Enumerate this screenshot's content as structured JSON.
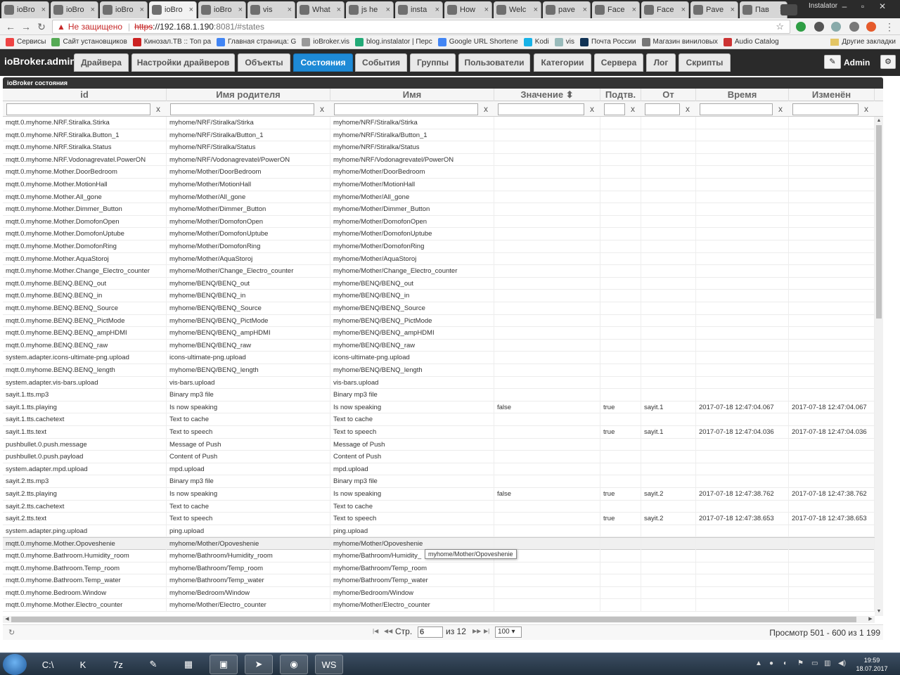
{
  "browser": {
    "tabs": [
      {
        "label": "ioBro",
        "icon": "iobroker-icon"
      },
      {
        "label": "ioBro",
        "icon": "iobroker-icon"
      },
      {
        "label": "ioBro",
        "icon": "iobroker-icon"
      },
      {
        "label": "ioBro",
        "icon": "iobroker-icon"
      },
      {
        "label": "ioBro",
        "icon": "iobroker-icon"
      },
      {
        "label": "vis",
        "icon": "vis-icon"
      },
      {
        "label": "What",
        "icon": "whatsapp-icon"
      },
      {
        "label": "js he",
        "icon": "google-icon"
      },
      {
        "label": "insta",
        "icon": "github-icon"
      },
      {
        "label": "How",
        "icon": "stackoverflow-icon"
      },
      {
        "label": "Welc",
        "icon": "page-icon"
      },
      {
        "label": "pave",
        "icon": "google-icon"
      },
      {
        "label": "Face",
        "icon": "facebook-icon"
      },
      {
        "label": "Face",
        "icon": "facebook-icon"
      },
      {
        "label": "Pave",
        "icon": "page-icon"
      },
      {
        "label": "Пав",
        "icon": "linkedin-icon"
      }
    ],
    "profile_name": "Instalator",
    "address": {
      "security_label": "Не защищено",
      "scheme": "https",
      "host": "://192.168.1.190",
      "rest": ":8081/#states"
    },
    "bookmarks": [
      {
        "label": "Сервисы",
        "color": "#e44"
      },
      {
        "label": "Сайт установщиков",
        "color": "#5a5"
      },
      {
        "label": "Кинозал.ТВ :: Топ ра",
        "color": "#c22"
      },
      {
        "label": "Главная страница: G",
        "color": "#4285f4"
      },
      {
        "label": "ioBroker.vis",
        "color": "#999"
      },
      {
        "label": "blog.instalator | Перс",
        "color": "#2a7"
      },
      {
        "label": "Google URL Shortene",
        "color": "#4285f4"
      },
      {
        "label": "Kodi",
        "color": "#17b2e7"
      },
      {
        "label": "vis",
        "color": "#9bb"
      },
      {
        "label": "Почта России",
        "color": "#135"
      },
      {
        "label": "Магазин виниловых",
        "color": "#777"
      },
      {
        "label": "Audio Catalog",
        "color": "#c33"
      }
    ],
    "other_bookmarks": "Другие закладки"
  },
  "app": {
    "brand": "ioBroker.admin",
    "nav": [
      {
        "label": "Драйвера",
        "active": false
      },
      {
        "label": "Настройки драйверов",
        "active": false
      },
      {
        "label": "Объекты",
        "active": false
      },
      {
        "label": "Состояния",
        "active": true
      },
      {
        "label": "События",
        "active": false
      },
      {
        "label": "Группы",
        "active": false
      },
      {
        "label": "Пользователи",
        "active": false
      },
      {
        "label": "Категории",
        "active": false
      },
      {
        "label": "Сервера",
        "active": false
      },
      {
        "label": "Лог",
        "active": false
      },
      {
        "label": "Скрипты",
        "active": false
      }
    ],
    "user": "Admin",
    "accent_color": "#1e8ad6"
  },
  "grid": {
    "title": "ioBroker состояния",
    "columns": [
      "id",
      "Имя родителя",
      "Имя",
      "Значение ⬍",
      "Подтв.",
      "От",
      "Время",
      "Изменён"
    ],
    "filter_clear": "x",
    "rows": [
      [
        "mqtt.0.myhome.NRF.Stiralka.Stirka",
        "myhome/NRF/Stiralka/Stirka",
        "myhome/NRF/Stiralka/Stirka",
        "",
        "",
        "",
        "",
        ""
      ],
      [
        "mqtt.0.myhome.NRF.Stiralka.Button_1",
        "myhome/NRF/Stiralka/Button_1",
        "myhome/NRF/Stiralka/Button_1",
        "",
        "",
        "",
        "",
        ""
      ],
      [
        "mqtt.0.myhome.NRF.Stiralka.Status",
        "myhome/NRF/Stiralka/Status",
        "myhome/NRF/Stiralka/Status",
        "",
        "",
        "",
        "",
        ""
      ],
      [
        "mqtt.0.myhome.NRF.Vodonagrevatel.PowerON",
        "myhome/NRF/Vodonagrevatel/PowerON",
        "myhome/NRF/Vodonagrevatel/PowerON",
        "",
        "",
        "",
        "",
        ""
      ],
      [
        "mqtt.0.myhome.Mother.DoorBedroom",
        "myhome/Mother/DoorBedroom",
        "myhome/Mother/DoorBedroom",
        "",
        "",
        "",
        "",
        ""
      ],
      [
        "mqtt.0.myhome.Mother.MotionHall",
        "myhome/Mother/MotionHall",
        "myhome/Mother/MotionHall",
        "",
        "",
        "",
        "",
        ""
      ],
      [
        "mqtt.0.myhome.Mother.All_gone",
        "myhome/Mother/All_gone",
        "myhome/Mother/All_gone",
        "",
        "",
        "",
        "",
        ""
      ],
      [
        "mqtt.0.myhome.Mother.Dimmer_Button",
        "myhome/Mother/Dimmer_Button",
        "myhome/Mother/Dimmer_Button",
        "",
        "",
        "",
        "",
        ""
      ],
      [
        "mqtt.0.myhome.Mother.DomofonOpen",
        "myhome/Mother/DomofonOpen",
        "myhome/Mother/DomofonOpen",
        "",
        "",
        "",
        "",
        ""
      ],
      [
        "mqtt.0.myhome.Mother.DomofonUptube",
        "myhome/Mother/DomofonUptube",
        "myhome/Mother/DomofonUptube",
        "",
        "",
        "",
        "",
        ""
      ],
      [
        "mqtt.0.myhome.Mother.DomofonRing",
        "myhome/Mother/DomofonRing",
        "myhome/Mother/DomofonRing",
        "",
        "",
        "",
        "",
        ""
      ],
      [
        "mqtt.0.myhome.Mother.AquaStoroj",
        "myhome/Mother/AquaStoroj",
        "myhome/Mother/AquaStoroj",
        "",
        "",
        "",
        "",
        ""
      ],
      [
        "mqtt.0.myhome.Mother.Change_Electro_counter",
        "myhome/Mother/Change_Electro_counter",
        "myhome/Mother/Change_Electro_counter",
        "",
        "",
        "",
        "",
        ""
      ],
      [
        "mqtt.0.myhome.BENQ.BENQ_out",
        "myhome/BENQ/BENQ_out",
        "myhome/BENQ/BENQ_out",
        "",
        "",
        "",
        "",
        ""
      ],
      [
        "mqtt.0.myhome.BENQ.BENQ_in",
        "myhome/BENQ/BENQ_in",
        "myhome/BENQ/BENQ_in",
        "",
        "",
        "",
        "",
        ""
      ],
      [
        "mqtt.0.myhome.BENQ.BENQ_Source",
        "myhome/BENQ/BENQ_Source",
        "myhome/BENQ/BENQ_Source",
        "",
        "",
        "",
        "",
        ""
      ],
      [
        "mqtt.0.myhome.BENQ.BENQ_PictMode",
        "myhome/BENQ/BENQ_PictMode",
        "myhome/BENQ/BENQ_PictMode",
        "",
        "",
        "",
        "",
        ""
      ],
      [
        "mqtt.0.myhome.BENQ.BENQ_ampHDMI",
        "myhome/BENQ/BENQ_ampHDMI",
        "myhome/BENQ/BENQ_ampHDMI",
        "",
        "",
        "",
        "",
        ""
      ],
      [
        "mqtt.0.myhome.BENQ.BENQ_raw",
        "myhome/BENQ/BENQ_raw",
        "myhome/BENQ/BENQ_raw",
        "",
        "",
        "",
        "",
        ""
      ],
      [
        "system.adapter.icons-ultimate-png.upload",
        "icons-ultimate-png.upload",
        "icons-ultimate-png.upload",
        "",
        "",
        "",
        "",
        ""
      ],
      [
        "mqtt.0.myhome.BENQ.BENQ_length",
        "myhome/BENQ/BENQ_length",
        "myhome/BENQ/BENQ_length",
        "",
        "",
        "",
        "",
        ""
      ],
      [
        "system.adapter.vis-bars.upload",
        "vis-bars.upload",
        "vis-bars.upload",
        "",
        "",
        "",
        "",
        ""
      ],
      [
        "sayit.1.tts.mp3",
        "Binary mp3 file",
        "Binary mp3 file",
        "",
        "",
        "",
        "",
        ""
      ],
      [
        "sayit.1.tts.playing",
        "Is now speaking",
        "Is now speaking",
        "false",
        "true",
        "sayit.1",
        "2017-07-18 12:47:04.067",
        "2017-07-18 12:47:04.067"
      ],
      [
        "sayit.1.tts.cachetext",
        "Text to cache",
        "Text to cache",
        "",
        "",
        "",
        "",
        ""
      ],
      [
        "sayit.1.tts.text",
        "Text to speech",
        "Text to speech",
        "",
        "true",
        "sayit.1",
        "2017-07-18 12:47:04.036",
        "2017-07-18 12:47:04.036"
      ],
      [
        "pushbullet.0.push.message",
        "Message of Push",
        "Message of Push",
        "",
        "",
        "",
        "",
        ""
      ],
      [
        "pushbullet.0.push.payload",
        "Content of Push",
        "Content of Push",
        "",
        "",
        "",
        "",
        ""
      ],
      [
        "system.adapter.mpd.upload",
        "mpd.upload",
        "mpd.upload",
        "",
        "",
        "",
        "",
        ""
      ],
      [
        "sayit.2.tts.mp3",
        "Binary mp3 file",
        "Binary mp3 file",
        "",
        "",
        "",
        "",
        ""
      ],
      [
        "sayit.2.tts.playing",
        "Is now speaking",
        "Is now speaking",
        "false",
        "true",
        "sayit.2",
        "2017-07-18 12:47:38.762",
        "2017-07-18 12:47:38.762"
      ],
      [
        "sayit.2.tts.cachetext",
        "Text to cache",
        "Text to cache",
        "",
        "",
        "",
        "",
        ""
      ],
      [
        "sayit.2.tts.text",
        "Text to speech",
        "Text to speech",
        "",
        "true",
        "sayit.2",
        "2017-07-18 12:47:38.653",
        "2017-07-18 12:47:38.653"
      ],
      [
        "system.adapter.ping.upload",
        "ping.upload",
        "ping.upload",
        "",
        "",
        "",
        "",
        ""
      ],
      [
        "mqtt.0.myhome.Mother.Opoveshenie",
        "myhome/Mother/Opoveshenie",
        "myhome/Mother/Opoveshenie",
        "",
        "",
        "",
        "",
        ""
      ],
      [
        "mqtt.0.myhome.Bathroom.Humidity_room",
        "myhome/Bathroom/Humidity_room",
        "myhome/Bathroom/Humidity_",
        "",
        "",
        "",
        "",
        ""
      ],
      [
        "mqtt.0.myhome.Bathroom.Temp_room",
        "myhome/Bathroom/Temp_room",
        "myhome/Bathroom/Temp_room",
        "",
        "",
        "",
        "",
        ""
      ],
      [
        "mqtt.0.myhome.Bathroom.Temp_water",
        "myhome/Bathroom/Temp_water",
        "myhome/Bathroom/Temp_water",
        "",
        "",
        "",
        "",
        ""
      ],
      [
        "mqtt.0.myhome.Bedroom.Window",
        "myhome/Bedroom/Window",
        "myhome/Bedroom/Window",
        "",
        "",
        "",
        "",
        ""
      ],
      [
        "mqtt.0.myhome.Mother.Electro_counter",
        "myhome/Mother/Electro_counter",
        "myhome/Mother/Electro_counter",
        "",
        "",
        "",
        "",
        ""
      ]
    ],
    "highlighted_row": 34,
    "tooltip": "myhome/Mother/Opoveshenie"
  },
  "pager": {
    "page_label": "Стр.",
    "page_value": "6",
    "of_label": "из 12",
    "per_page": "100 ▾",
    "view_info": "Просмотр 501 - 600 из 1 199"
  },
  "taskbar": {
    "apps": [
      {
        "icon": "terminal-icon",
        "glyph": "C:\\"
      },
      {
        "icon": "kodi-icon",
        "glyph": "K"
      },
      {
        "icon": "7zip-icon",
        "glyph": "7z"
      },
      {
        "icon": "paint-icon",
        "glyph": "✎"
      },
      {
        "icon": "calculator-icon",
        "glyph": "▦"
      },
      {
        "icon": "save-icon",
        "glyph": "▣"
      },
      {
        "icon": "telegram-icon",
        "glyph": "➤"
      },
      {
        "icon": "chrome-icon",
        "glyph": "◉"
      },
      {
        "icon": "webstorm-icon",
        "glyph": "WS"
      }
    ],
    "time": "19:59",
    "date": "18.07.2017"
  }
}
